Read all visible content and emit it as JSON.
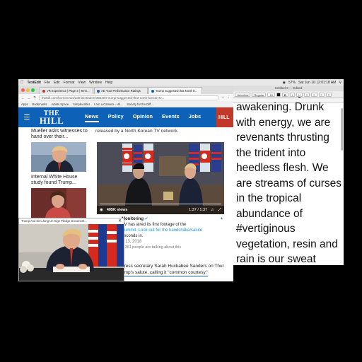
{
  "menubar": {
    "app": "TextEdit",
    "items": [
      "File",
      "Edit",
      "Format",
      "View",
      "Window",
      "Help"
    ],
    "clock": "Sat Jun 16  12:01:18 AM",
    "battery": "57%"
  },
  "browser": {
    "tabs": [
      {
        "label": "VR Experience | Page 3 | Tenn...",
        "fav_color": "#c0392b"
      },
      {
        "label": "AD Your Performance Ratings",
        "fav_color": "#1f5fa8"
      },
      {
        "label": "Trump suggested that North K...",
        "fav_color": "#0d62b8"
      }
    ],
    "url": "thehill.com/homenews/administration/392404-trump-suggested-that-north-korean-tv...",
    "bookmarks": [
      "Apps",
      "Bookmarks",
      "Artists Space",
      "SimpleAdder",
      "I Am a Camera - Hil...",
      "Society for the Diff..."
    ]
  },
  "hill": {
    "logo_line1": "THE",
    "logo_line2": "HILL",
    "nav": [
      "News",
      "Policy",
      "Opinion",
      "Events",
      "Jobs"
    ],
    "nav_right": "HILL"
  },
  "sidebar": {
    "item1": "Mueller asks witnesses to hand over their...",
    "item2": "Internal White House study found Trump..."
  },
  "article": {
    "intro": "released by a North Korean TV network.",
    "video_views": "405K views",
    "video_time": "1:37 / 1:37"
  },
  "tweet": {
    "name": "Monitoring",
    "line1": "TV has aired its first footage of the",
    "line2": "Summit. Look out for the handshake/salute",
    "line3": "seconds in.",
    "date": "n 13, 2018",
    "talking": "2,361 people are talking about this"
  },
  "body": {
    "line1": "press secretary Sarah Huckabee Sanders on Thur",
    "line2": "ump's salute, calling it \"common courtesy.\""
  },
  "photo_window": {
    "title": "Trump And Kim Jong Un Sign Pledge Document..."
  },
  "textedit": {
    "title": "Untitled 3 — Edited",
    "font": "Helvetica",
    "style": "Regular",
    "size": "18",
    "text": "awakening. Drunk with energy, we are revenants thrusting the trident into heedless flesh. We are streams of curses in the tropical abundance of #vertiginous vegetation, resin and rain is our sweat"
  }
}
